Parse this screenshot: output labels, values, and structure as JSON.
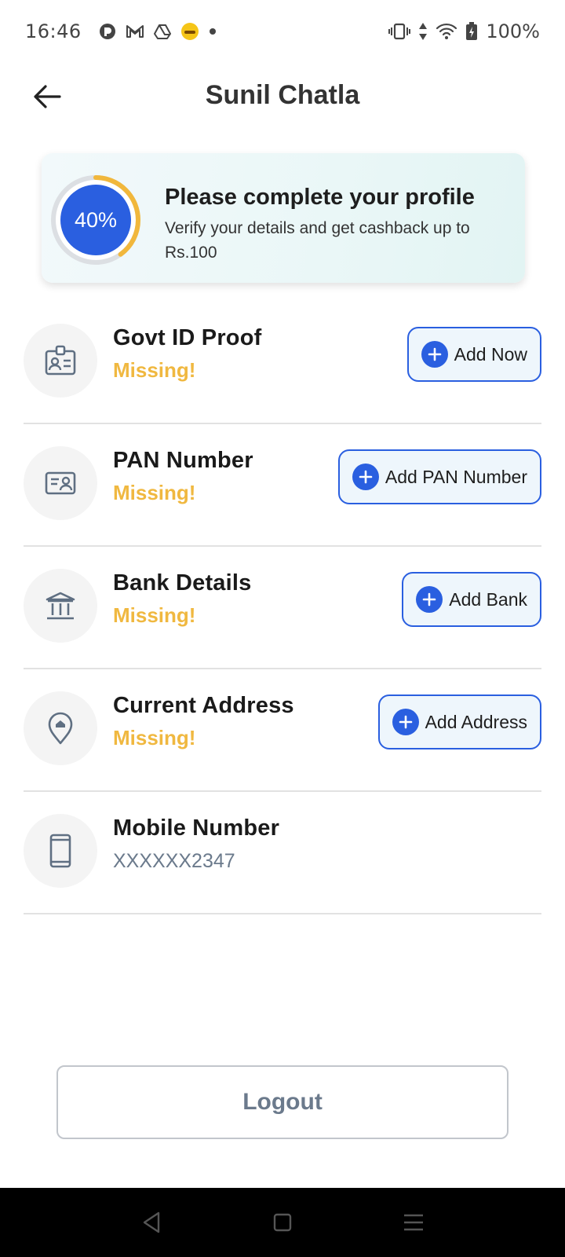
{
  "status_bar": {
    "time": "16:46",
    "battery": "100%"
  },
  "header": {
    "title": "Sunil Chatla",
    "back_icon": "arrow-left-icon"
  },
  "profile_card": {
    "progress_label": "40%",
    "progress_fraction": 0.4,
    "title": "Please complete your profile",
    "subtitle": "Verify your details and get cashback up to Rs.100",
    "colors": {
      "ring_fill": "#f1b73c",
      "ring_track": "#dcdfe3",
      "inner": "#2a5fe0"
    }
  },
  "items": [
    {
      "title": "Govt ID Proof",
      "status": "Missing!",
      "button": "Add Now",
      "icon": "id-badge-icon"
    },
    {
      "title": "PAN Number",
      "status": "Missing!",
      "button": "Add PAN Number",
      "icon": "id-card-icon"
    },
    {
      "title": "Bank Details",
      "status": "Missing!",
      "button": "Add Bank",
      "icon": "bank-icon"
    },
    {
      "title": "Current Address",
      "status": "Missing!",
      "button": "Add Address",
      "icon": "location-home-icon"
    },
    {
      "title": "Mobile Number",
      "value": "XXXXXX2347",
      "icon": "mobile-phone-icon"
    }
  ],
  "logout": {
    "label": "Logout"
  },
  "colors": {
    "accent": "#2a5fe0",
    "warning": "#f0b840",
    "muted": "#6b7a8c"
  }
}
